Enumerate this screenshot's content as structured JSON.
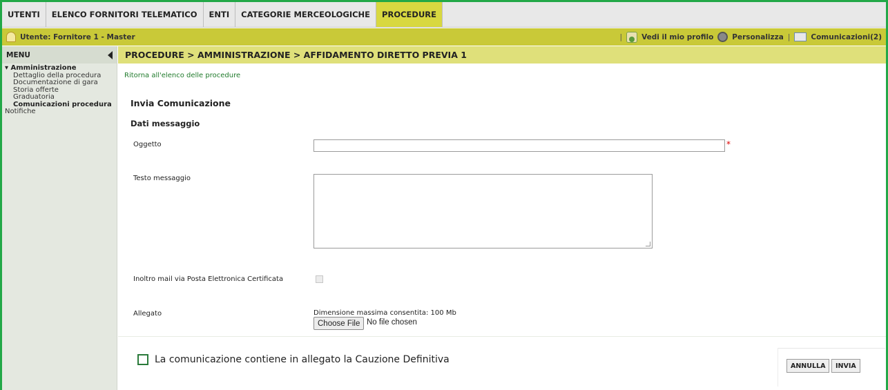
{
  "topnav": {
    "tabs": [
      "UTENTI",
      "ELENCO FORNITORI TELEMATICO",
      "ENTI",
      "CATEGORIE MERCEOLOGICHE",
      "PROCEDURE"
    ],
    "active": "PROCEDURE"
  },
  "userbar": {
    "user": "Utente: Fornitore 1 - Master",
    "profile": "Vedi il mio profilo",
    "personalize": "Personalizza",
    "communications": "Comunicazioni(2)"
  },
  "sidebar": {
    "title": "MENU",
    "group": "▾ Amministrazione",
    "items": [
      {
        "label": "Dettaglio della procedura",
        "active": false
      },
      {
        "label": "Documentazione di gara",
        "active": false
      },
      {
        "label": "Storia offerte",
        "active": false
      },
      {
        "label": "Graduatoria",
        "active": false
      },
      {
        "label": "Comunicazioni procedura",
        "active": true
      }
    ],
    "notifiche": "Notifiche"
  },
  "breadcrumb": "PROCEDURE  > AMMINISTRAZIONE  > AFFIDAMENTO DIRETTO PREVIA 1",
  "main": {
    "back_link": "Ritorna all'elenco delle procedure",
    "section_title": "Invia Comunicazione",
    "sub_title": "Dati messaggio",
    "oggetto_label": "Oggetto",
    "oggetto_value": "",
    "required_mark": "*",
    "testo_label": "Testo messaggio",
    "testo_value": "",
    "pec_label": "Inoltro mail via Posta Elettronica Certificata",
    "pec_checked": true,
    "allegato_label": "Allegato",
    "dim_note": "Dimensione massima consentita: 100 Mb",
    "file_button": "Choose File",
    "file_status": "No file chosen",
    "cauzione_label": "La comunicazione contiene in allegato la Cauzione Definitiva",
    "cauzione_checked": false,
    "annulla": "ANNULLA",
    "invia": "INVIA"
  },
  "colors": {
    "frame": "#22a847",
    "active_tab": "#d8d840",
    "userbar": "#c9c938",
    "breadcrumb_bar": "#dfe07a",
    "link": "#1f7a2b"
  }
}
